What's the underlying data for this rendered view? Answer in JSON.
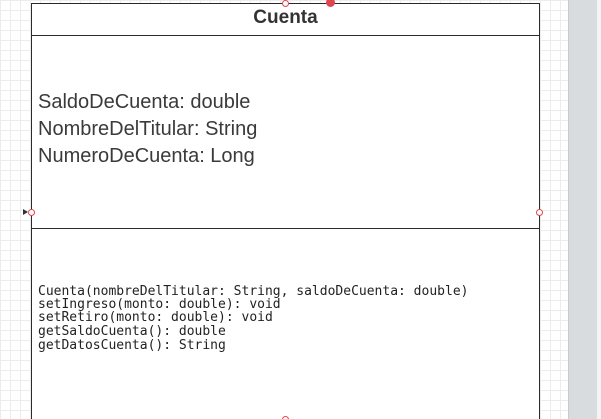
{
  "diagram": {
    "class_name": "Cuenta",
    "attributes": [
      "SaldoDeCuenta: double",
      "NombreDelTitular: String",
      "NumeroDeCuenta: Long"
    ],
    "methods": [
      "Cuenta(nombreDelTitular: String, saldoDeCuenta: double)",
      "setIngreso(monto: double): void",
      "setRetiro(monto: double): void",
      "getSaldoCuenta(): double",
      "getDatosCuenta(): String"
    ]
  },
  "colors": {
    "handle": "#e0464f",
    "border": "#2b2b2b",
    "side_panel": "#d9dcde"
  }
}
